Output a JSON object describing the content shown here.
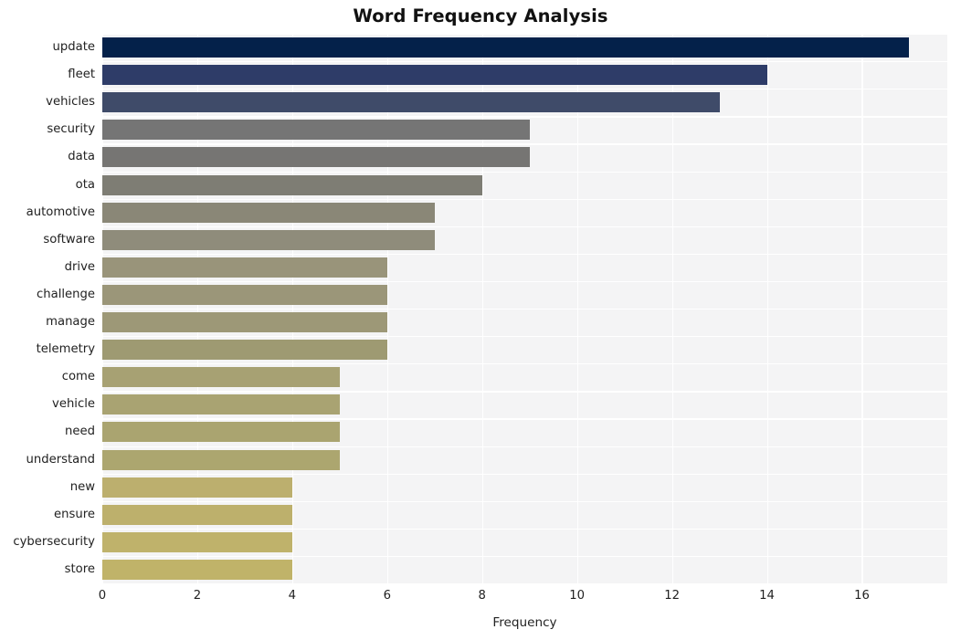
{
  "chart_data": {
    "type": "bar",
    "orientation": "horizontal",
    "title": "Word Frequency Analysis",
    "xlabel": "Frequency",
    "ylabel": "",
    "categories": [
      "update",
      "fleet",
      "vehicles",
      "security",
      "data",
      "ota",
      "automotive",
      "software",
      "drive",
      "challenge",
      "manage",
      "telemetry",
      "come",
      "vehicle",
      "need",
      "understand",
      "new",
      "ensure",
      "cybersecurity",
      "store"
    ],
    "values": [
      17,
      14,
      13,
      9,
      9,
      8,
      7,
      7,
      6,
      6,
      6,
      6,
      5,
      5,
      5,
      5,
      4,
      4,
      4,
      4
    ],
    "bar_colors": [
      "#04214a",
      "#2e3c68",
      "#3f4b69",
      "#757575",
      "#767573",
      "#7e7d74",
      "#8a8777",
      "#8f8c7b",
      "#99947a",
      "#9b9679",
      "#9d9877",
      "#9e9a72",
      "#a7a173",
      "#a9a372",
      "#aaa470",
      "#aca66f",
      "#bcaf6e",
      "#bdb06c",
      "#bfb26b",
      "#c0b369"
    ],
    "xticks": [
      0,
      2,
      4,
      6,
      8,
      10,
      12,
      14,
      16
    ],
    "xtick_labels": [
      "0",
      "2",
      "4",
      "6",
      "8",
      "10",
      "12",
      "14",
      "16"
    ],
    "xlim": [
      0,
      17.8
    ],
    "grid": true,
    "grid_color": "#ffffff",
    "plot_background": "#f4f4f5",
    "figure_background": "#ffffff",
    "legend": null,
    "style": "whitegrid"
  }
}
